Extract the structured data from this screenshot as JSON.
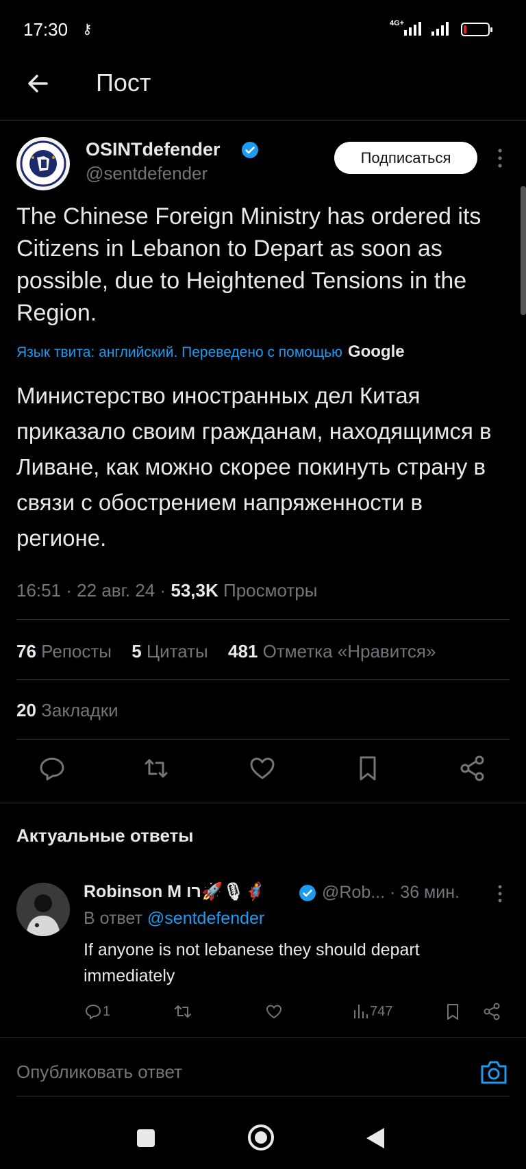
{
  "status_bar": {
    "time": "17:30",
    "network": "4G+",
    "battery_color": "#e0262a",
    "battery_level": 0.12
  },
  "header": {
    "title": "Пост"
  },
  "post": {
    "author_name": "OSINTdefender",
    "author_handle": "@sentdefender",
    "follow_label": "Подписаться",
    "text": "The Chinese Foreign Ministry has ordered its Citizens in Lebanon to Depart as soon as possible, due to Heightened Tensions in the Region.",
    "translation_note": "Язык твита: английский. Переведено с помощью",
    "translation_provider": "Google",
    "translated_text": "Министерство иностранных дел Китая приказало своим гражданам, находящимся в Ливане, как можно скорее покинуть страну в связи с обострением напряженности в регионе.",
    "timestamp": "16:51 · 22 авг. 24 ·",
    "views_count": "53,3K",
    "views_label": "Просмотры",
    "reposts_count": "76",
    "reposts_label": "Репосты",
    "quotes_count": "5",
    "quotes_label": "Цитаты",
    "likes_count": "481",
    "likes_label": "Отметка «Нравится»",
    "bookmarks_count": "20",
    "bookmarks_label": "Закладки"
  },
  "replies_section": {
    "title": "Актуальные ответы"
  },
  "reply": {
    "author_name": "Robinson M רו🚀🎙🦸",
    "author_handle": "@Rob... · 36 мин.",
    "replying_prefix": "В ответ",
    "replying_to": "@sentdefender",
    "text": "If anyone is not lebanese they should depart immediately",
    "reply_count": "1",
    "views_count": "747"
  },
  "composer": {
    "placeholder": "Опубликовать ответ"
  },
  "colors": {
    "accent": "#1d9bf0",
    "background": "#000000",
    "text": "#e7e9ea",
    "muted": "#71767b"
  }
}
